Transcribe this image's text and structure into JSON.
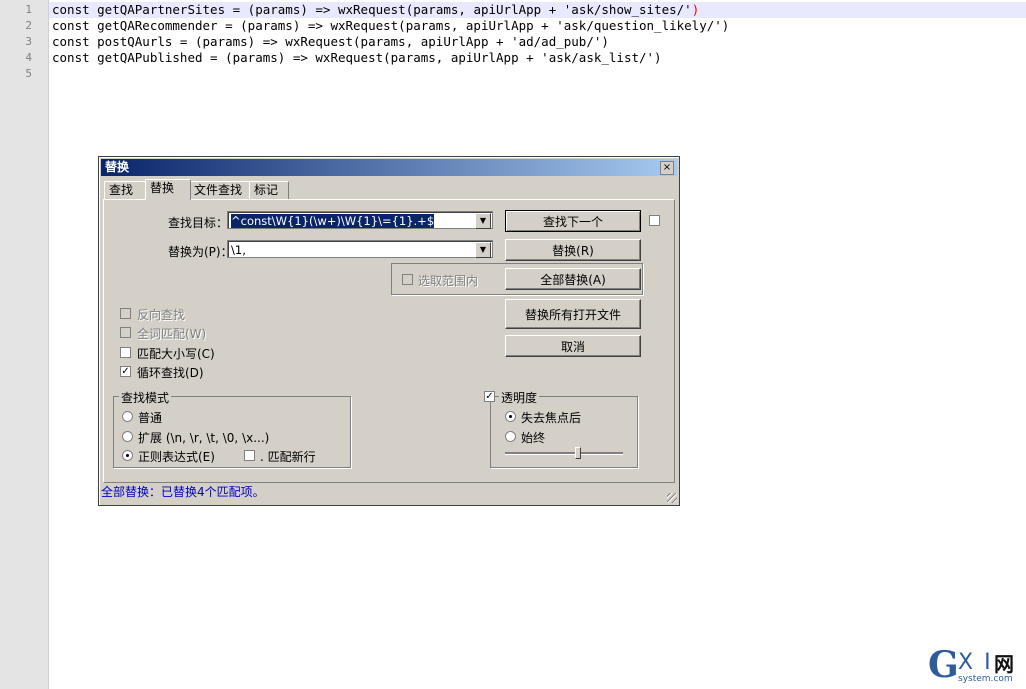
{
  "editor": {
    "line_numbers": [
      "1",
      "2",
      "3",
      "4",
      "5"
    ],
    "lines": [
      {
        "pre": "const getQAPartnerSites = (params) => wxRequest",
        "paren_open": "(",
        "mid": "params, apiUrlApp + 'ask/show_sites/'",
        "paren_close": ")"
      },
      {
        "text": "const getQARecommender = (params) => wxRequest(params, apiUrlApp + 'ask/question_likely/')"
      },
      {
        "text": "const postQAurls = (params) => wxRequest(params, apiUrlApp + 'ad/ad_pub/')"
      },
      {
        "text": "const getQAPublished = (params) => wxRequest(params, apiUrlApp + 'ask/ask_list/')"
      },
      {
        "text": ""
      }
    ]
  },
  "dialog": {
    "title": "替换",
    "close_glyph": "×",
    "tabs": [
      "查找",
      "替换",
      "文件查找",
      "标记"
    ],
    "find_label": "查找目标：",
    "find_value": "^const\\W{1}(\\w+)\\W{1}\\={1}.+$",
    "replace_label": "替换为(P)：",
    "replace_value": "\\1,",
    "buttons": {
      "find_next": "查找下一个",
      "replace": "替换(R)",
      "replace_all": "全部替换(A)",
      "replace_all_open": "替换所有打开文件",
      "cancel": "取消"
    },
    "in_selection": "选取范围内",
    "options": {
      "backward": "反向查找",
      "whole_word": "全词匹配(W)",
      "match_case": "匹配大小写(C)",
      "wrap": "循环查找(D)"
    },
    "search_mode": {
      "title": "查找模式",
      "normal": "普通",
      "extended": "扩展 (\\n, \\r, \\t, \\0, \\x...)",
      "regex": "正则表达式(E)",
      "dot_newline": ". 匹配新行"
    },
    "transparency": {
      "title": "透明度",
      "on_lose_focus": "失去焦点后",
      "always": "始终",
      "level": 0.62
    },
    "status": "全部替换：已替换4个匹配项。"
  },
  "watermark": {
    "g": "G",
    "xi": "X I",
    "cn": "网",
    "sub": "system.com"
  },
  "colors": {
    "title_start": "#0a246a",
    "title_end": "#a6caf0",
    "status_text": "#0000c0",
    "paren_highlight": "#ff0000"
  }
}
